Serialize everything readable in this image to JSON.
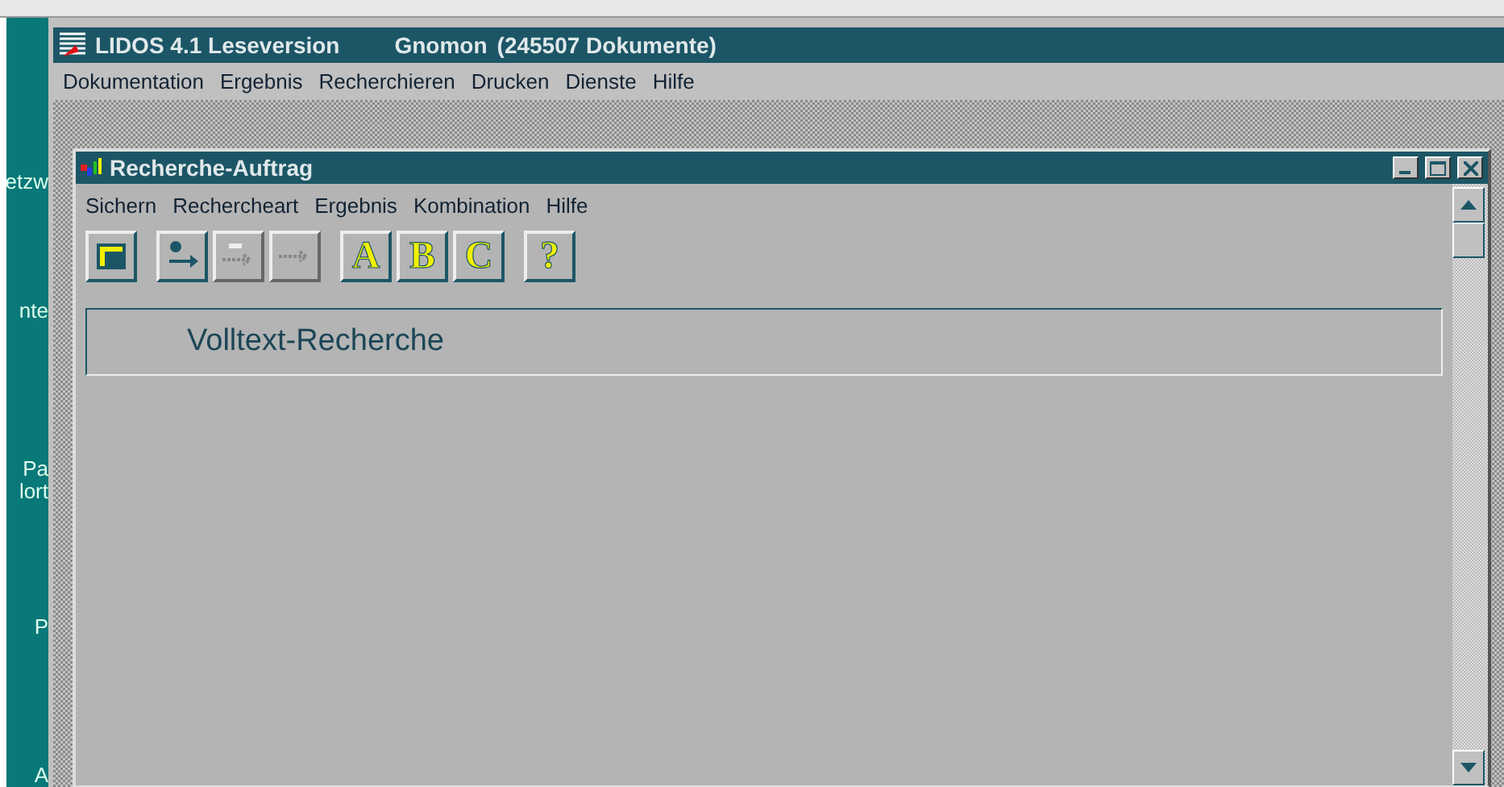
{
  "desktop": {
    "labels": [
      "etzw",
      "nte",
      "Pa",
      "lort",
      "P",
      "A"
    ]
  },
  "window": {
    "title": "LIDOS 4.1 Leseversion",
    "database": "Gnomon",
    "count": "(245507 Dokumente)"
  },
  "menu": [
    "Dokumentation",
    "Ergebnis",
    "Recherchieren",
    "Drucken",
    "Dienste",
    "Hilfe"
  ],
  "child": {
    "title": "Recherche-Auftrag",
    "menu": [
      "Sichern",
      "Rechercheart",
      "Ergebnis",
      "Kombination",
      "Hilfe"
    ],
    "toolbar": [
      {
        "kind": "icon",
        "disabled": false
      },
      {
        "kind": "icon",
        "disabled": false
      },
      {
        "kind": "icon",
        "disabled": true
      },
      {
        "kind": "icon",
        "disabled": true
      },
      {
        "kind": "text",
        "label": "A",
        "disabled": false
      },
      {
        "kind": "text",
        "label": "B",
        "disabled": false
      },
      {
        "kind": "text",
        "label": "C",
        "disabled": false
      },
      {
        "kind": "text",
        "label": "?",
        "disabled": false
      }
    ],
    "field": {
      "value": "Volltext-Recherche"
    }
  }
}
